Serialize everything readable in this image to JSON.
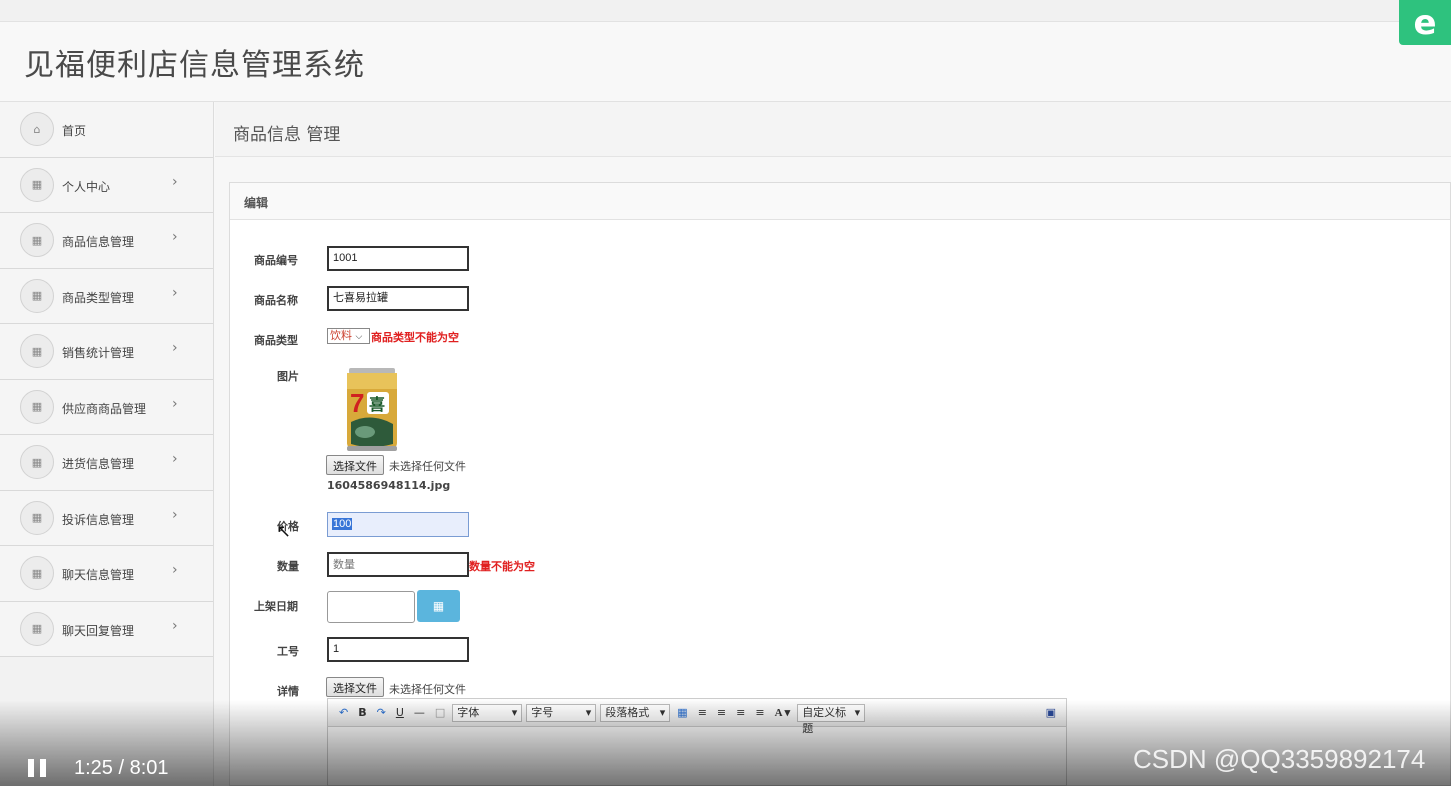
{
  "header": {
    "title": "见福便利店信息管理系统",
    "corner_logo": "e"
  },
  "sidebar": {
    "items": [
      {
        "label": "首页",
        "icon": "home-icon",
        "has_chevron": false
      },
      {
        "label": "个人中心",
        "icon": "grid-icon",
        "has_chevron": true
      },
      {
        "label": "商品信息管理",
        "icon": "grid-icon",
        "has_chevron": true
      },
      {
        "label": "商品类型管理",
        "icon": "grid-icon",
        "has_chevron": true
      },
      {
        "label": "销售统计管理",
        "icon": "grid-icon",
        "has_chevron": true
      },
      {
        "label": "供应商商品管理",
        "icon": "grid-icon",
        "has_chevron": true
      },
      {
        "label": "进货信息管理",
        "icon": "grid-icon",
        "has_chevron": true
      },
      {
        "label": "投诉信息管理",
        "icon": "grid-icon",
        "has_chevron": true
      },
      {
        "label": "聊天信息管理",
        "icon": "grid-icon",
        "has_chevron": true
      },
      {
        "label": "聊天回复管理",
        "icon": "grid-icon",
        "has_chevron": true
      }
    ]
  },
  "page": {
    "title": "商品信息 管理"
  },
  "form": {
    "panel_title": "编辑",
    "code": {
      "label": "商品编号",
      "value": "1001"
    },
    "name": {
      "label": "商品名称",
      "value": "七喜易拉罐"
    },
    "type": {
      "label": "商品类型",
      "value": "饮料",
      "error": "商品类型不能为空"
    },
    "image": {
      "label": "图片",
      "file_button": "选择文件",
      "file_note": "未选择任何文件",
      "filename": "1604586948114.jpg"
    },
    "price": {
      "label": "价格",
      "value": "100"
    },
    "quantity": {
      "label": "数量",
      "placeholder": "数量",
      "error": "数量不能为空"
    },
    "date": {
      "label": "上架日期",
      "value": ""
    },
    "staff_no": {
      "label": "工号",
      "value": "1"
    },
    "details": {
      "label": "详情",
      "file_button": "选择文件",
      "file_note": "未选择任何文件"
    }
  },
  "editor_toolbar": {
    "font": "字体",
    "size": "字号",
    "paragraph": "段落格式",
    "custom_title": "自定义标题"
  },
  "video": {
    "time": "1:25 / 8:01",
    "watermark": "CSDN @QQ3359892174"
  }
}
